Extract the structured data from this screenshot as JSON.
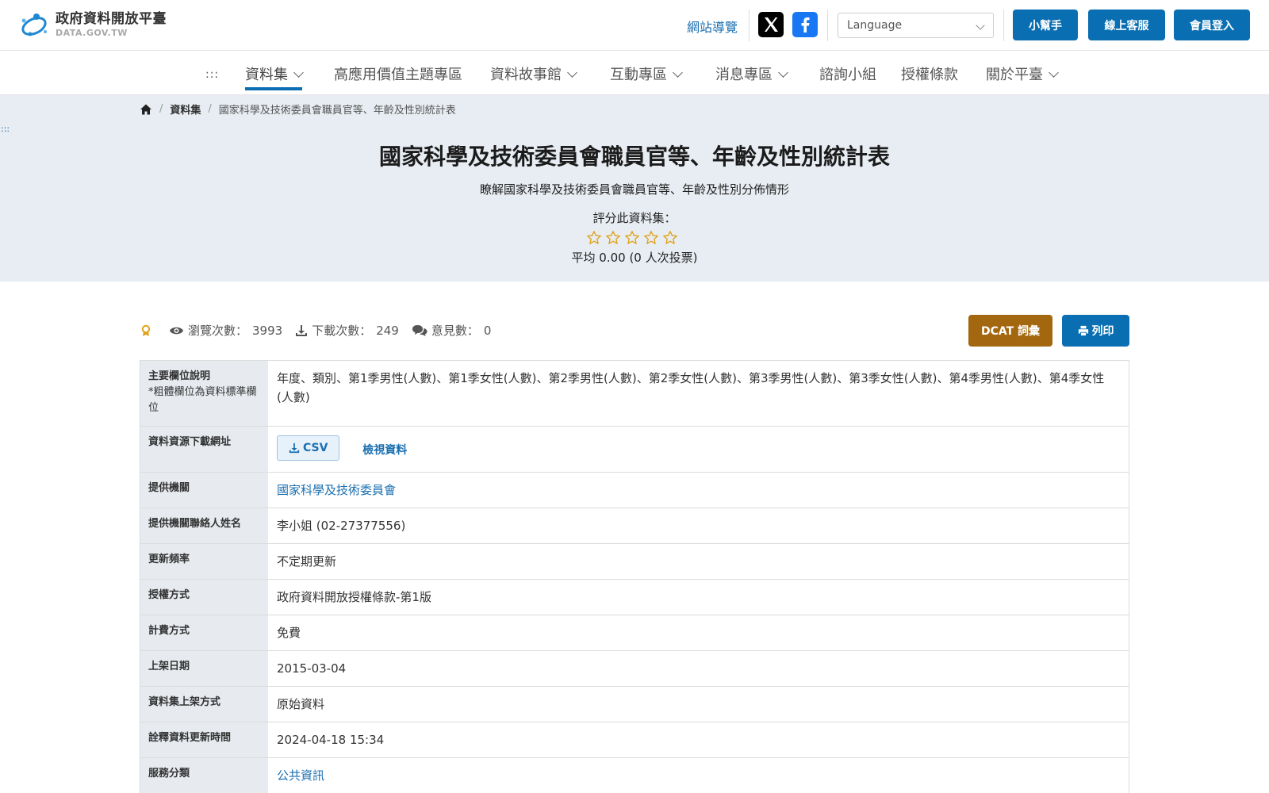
{
  "header": {
    "logo_main": "政府資料開放平臺",
    "logo_sub": "DATA.GOV.TW",
    "sitemap": "網站導覽",
    "language_placeholder": "Language",
    "buttons": {
      "helper": "小幫手",
      "service": "線上客服",
      "login": "會員登入"
    }
  },
  "nav": {
    "dots": ":::",
    "items": [
      {
        "label": "資料集"
      },
      {
        "label": "高應用價值主題專區"
      },
      {
        "label": "資料故事館"
      },
      {
        "label": "互動專區"
      },
      {
        "label": "消息專區"
      },
      {
        "label": "諮詢小組"
      },
      {
        "label": "授權條款"
      },
      {
        "label": "關於平臺"
      }
    ]
  },
  "breadcrumb": {
    "sep": "/",
    "items": [
      "資料集",
      "國家科學及技術委員會職員官等、年齡及性別統計表"
    ]
  },
  "skip_dots": ":::",
  "dataset": {
    "title": "國家科學及技術委員會職員官等、年齡及性別統計表",
    "description": "瞭解國家科學及技術委員會職員官等、年齡及性別分佈情形",
    "rating_label": "評分此資料集：",
    "rating_value": 0,
    "rating_max": 5,
    "rating_avg": "平均 0.00 (0 人次投票)"
  },
  "stats": {
    "views_label": "瀏覽次數：",
    "views": "3993",
    "downloads_label": "下載次數：",
    "downloads": "249",
    "comments_label": "意見數：",
    "comments": "0"
  },
  "actions": {
    "dcat": "DCAT 詞彙",
    "print": "列印"
  },
  "colors": {
    "primary": "#0a6eb2",
    "dcat": "#a3670f",
    "hero_bg": "#e8edf3",
    "label_bg": "#e7ebf0",
    "link": "#1a6fb0"
  },
  "table": {
    "fields_label": "主要欄位說明",
    "fields_note": "*粗體欄位為資料標準欄位",
    "fields_value": "年度、類別、第1季男性(人數)、第1季女性(人數)、第2季男性(人數)、第2季女性(人數)、第3季男性(人數)、第3季女性(人數)、第4季男性(人數)、第4季女性(人數)",
    "download_label": "資料資源下載網址",
    "csv_label": "CSV",
    "view_label": "檢視資料",
    "provider_label": "提供機關",
    "provider_value": "國家科學及技術委員會",
    "contact_label": "提供機關聯絡人姓名",
    "contact_value": "李小姐 (02-27377556)",
    "frequency_label": "更新頻率",
    "frequency_value": "不定期更新",
    "license_label": "授權方式",
    "license_value": "政府資料開放授權條款-第1版",
    "fee_label": "計費方式",
    "fee_value": "免費",
    "date_label": "上架日期",
    "date_value": "2015-03-04",
    "method_label": "資料集上架方式",
    "method_value": "原始資料",
    "meta_update_label": "詮釋資料更新時間",
    "meta_update_value": "2024-04-18 15:34",
    "category_label": "服務分類",
    "category_value": "公共資訊"
  }
}
